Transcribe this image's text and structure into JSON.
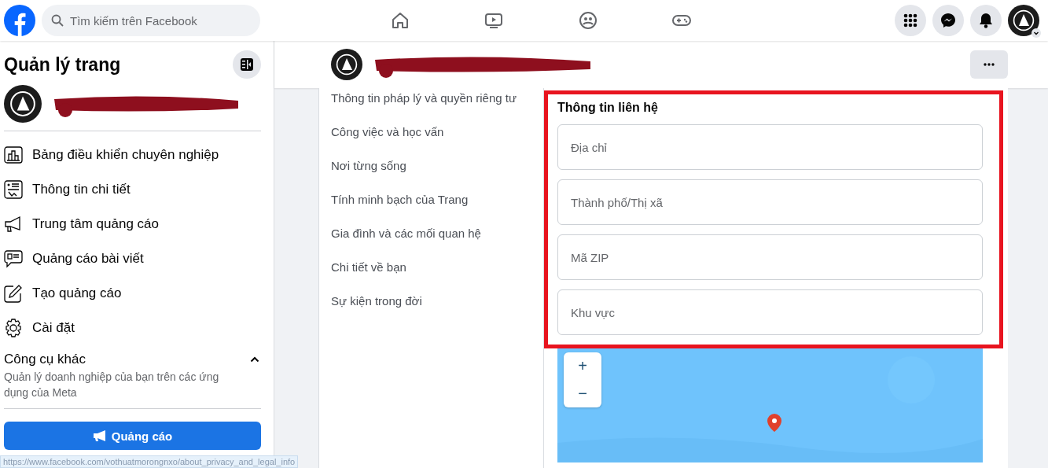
{
  "top_bar": {
    "search": {
      "placeholder": "Tìm kiếm trên Facebook"
    }
  },
  "sidebar": {
    "title": "Quản lý trang",
    "items": [
      {
        "kind": "dashboard",
        "label": "Bảng điều khiển chuyên nghiệp"
      },
      {
        "kind": "insights",
        "label": "Thông tin chi tiết"
      },
      {
        "kind": "megaphone",
        "label": "Trung tâm quảng cáo"
      },
      {
        "kind": "post-ad",
        "label": "Quảng cáo bài viết"
      },
      {
        "kind": "create-ad",
        "label": "Tạo quảng cáo"
      },
      {
        "kind": "settings",
        "label": "Cài đặt"
      }
    ],
    "tools": {
      "title": "Công cụ khác",
      "expanded": true,
      "description": "Quản lý doanh nghiệp của bạn trên các ứng dụng của Meta"
    },
    "button": "Quảng cáo"
  },
  "about_nav": {
    "items": [
      "Thông tin pháp lý và quyền riêng tư",
      "Công việc và học vấn",
      "Nơi từng sống",
      "Tính minh bạch của Trang",
      "Gia đình và các mối quan hệ",
      "Chi tiết về bạn",
      "Sự kiện trong đời"
    ]
  },
  "contact": {
    "title": "Thông tin liên hệ",
    "fields": [
      {
        "placeholder": "Địa chỉ"
      },
      {
        "placeholder": "Thành phố/Thị xã"
      },
      {
        "placeholder": "Mã ZIP"
      },
      {
        "placeholder": "Khu vực"
      }
    ]
  },
  "map": {
    "zoom_buttons": [
      "+",
      "−"
    ]
  },
  "status_bar": {
    "url": "https://www.facebook.com/vothuatmorongnxo/about_privacy_and_legal_info"
  }
}
